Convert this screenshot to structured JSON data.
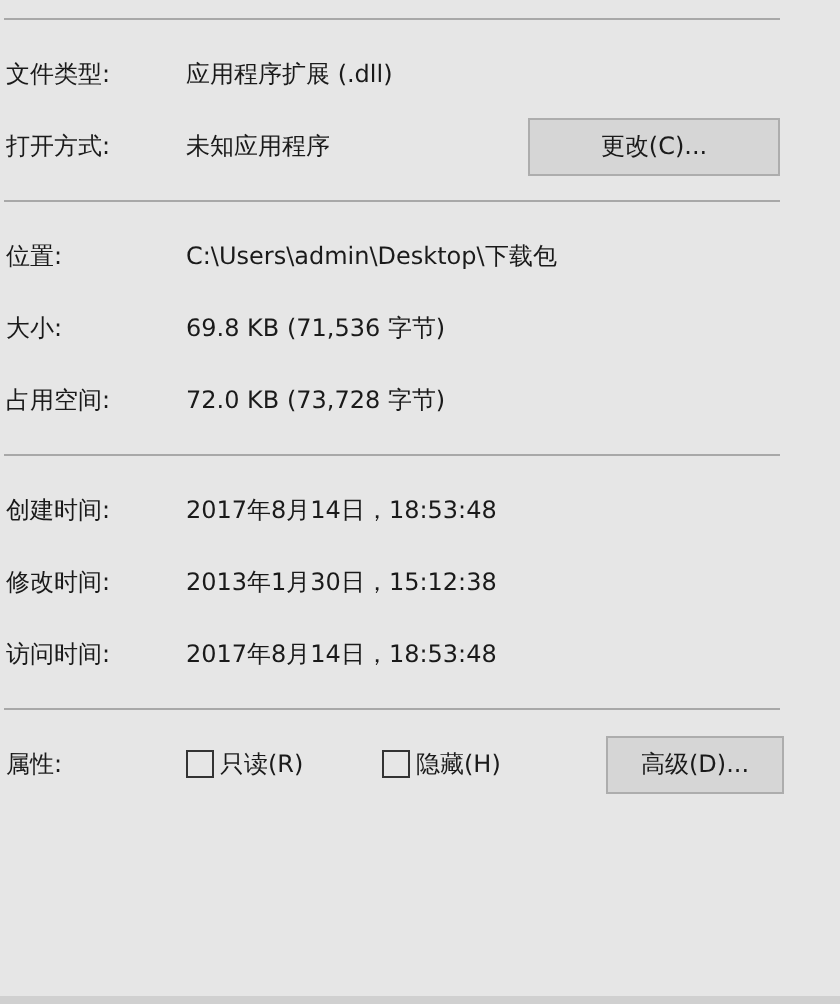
{
  "sections": [
    {
      "rows": [
        {
          "label": "文件类型:",
          "value": "应用程序扩展 (.dll)"
        },
        {
          "label": "打开方式:",
          "value": "未知应用程序",
          "button": "更改(C)..."
        }
      ]
    },
    {
      "rows": [
        {
          "label": "位置:",
          "value": "C:\\Users\\admin\\Desktop\\下载包"
        },
        {
          "label": "大小:",
          "value": "69.8 KB (71,536 字节)"
        },
        {
          "label": "占用空间:",
          "value": "72.0 KB (73,728 字节)"
        }
      ]
    },
    {
      "rows": [
        {
          "label": "创建时间:",
          "value": "2017年8月14日，18:53:48"
        },
        {
          "label": "修改时间:",
          "value": "2013年1月30日，15:12:38"
        },
        {
          "label": "访问时间:",
          "value": "2017年8月14日，18:53:48"
        }
      ]
    }
  ],
  "attributes": {
    "label": "属性:",
    "checkboxes": [
      {
        "label": "只读(R)",
        "checked": false
      },
      {
        "label": "隐藏(H)",
        "checked": false
      }
    ],
    "button": "高级(D)..."
  }
}
